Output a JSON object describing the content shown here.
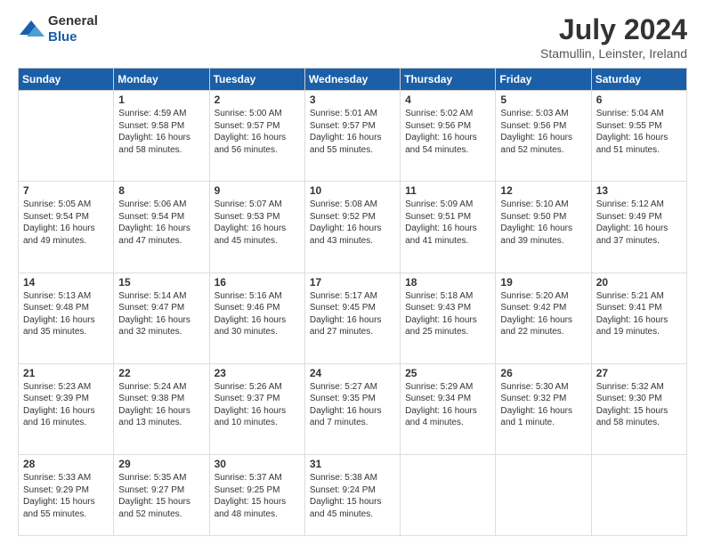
{
  "header": {
    "logo_general": "General",
    "logo_blue": "Blue",
    "title": "July 2024",
    "subtitle": "Stamullin, Leinster, Ireland"
  },
  "columns": [
    "Sunday",
    "Monday",
    "Tuesday",
    "Wednesday",
    "Thursday",
    "Friday",
    "Saturday"
  ],
  "weeks": [
    [
      {
        "day": "",
        "content": ""
      },
      {
        "day": "1",
        "content": "Sunrise: 4:59 AM\nSunset: 9:58 PM\nDaylight: 16 hours\nand 58 minutes."
      },
      {
        "day": "2",
        "content": "Sunrise: 5:00 AM\nSunset: 9:57 PM\nDaylight: 16 hours\nand 56 minutes."
      },
      {
        "day": "3",
        "content": "Sunrise: 5:01 AM\nSunset: 9:57 PM\nDaylight: 16 hours\nand 55 minutes."
      },
      {
        "day": "4",
        "content": "Sunrise: 5:02 AM\nSunset: 9:56 PM\nDaylight: 16 hours\nand 54 minutes."
      },
      {
        "day": "5",
        "content": "Sunrise: 5:03 AM\nSunset: 9:56 PM\nDaylight: 16 hours\nand 52 minutes."
      },
      {
        "day": "6",
        "content": "Sunrise: 5:04 AM\nSunset: 9:55 PM\nDaylight: 16 hours\nand 51 minutes."
      }
    ],
    [
      {
        "day": "7",
        "content": "Sunrise: 5:05 AM\nSunset: 9:54 PM\nDaylight: 16 hours\nand 49 minutes."
      },
      {
        "day": "8",
        "content": "Sunrise: 5:06 AM\nSunset: 9:54 PM\nDaylight: 16 hours\nand 47 minutes."
      },
      {
        "day": "9",
        "content": "Sunrise: 5:07 AM\nSunset: 9:53 PM\nDaylight: 16 hours\nand 45 minutes."
      },
      {
        "day": "10",
        "content": "Sunrise: 5:08 AM\nSunset: 9:52 PM\nDaylight: 16 hours\nand 43 minutes."
      },
      {
        "day": "11",
        "content": "Sunrise: 5:09 AM\nSunset: 9:51 PM\nDaylight: 16 hours\nand 41 minutes."
      },
      {
        "day": "12",
        "content": "Sunrise: 5:10 AM\nSunset: 9:50 PM\nDaylight: 16 hours\nand 39 minutes."
      },
      {
        "day": "13",
        "content": "Sunrise: 5:12 AM\nSunset: 9:49 PM\nDaylight: 16 hours\nand 37 minutes."
      }
    ],
    [
      {
        "day": "14",
        "content": "Sunrise: 5:13 AM\nSunset: 9:48 PM\nDaylight: 16 hours\nand 35 minutes."
      },
      {
        "day": "15",
        "content": "Sunrise: 5:14 AM\nSunset: 9:47 PM\nDaylight: 16 hours\nand 32 minutes."
      },
      {
        "day": "16",
        "content": "Sunrise: 5:16 AM\nSunset: 9:46 PM\nDaylight: 16 hours\nand 30 minutes."
      },
      {
        "day": "17",
        "content": "Sunrise: 5:17 AM\nSunset: 9:45 PM\nDaylight: 16 hours\nand 27 minutes."
      },
      {
        "day": "18",
        "content": "Sunrise: 5:18 AM\nSunset: 9:43 PM\nDaylight: 16 hours\nand 25 minutes."
      },
      {
        "day": "19",
        "content": "Sunrise: 5:20 AM\nSunset: 9:42 PM\nDaylight: 16 hours\nand 22 minutes."
      },
      {
        "day": "20",
        "content": "Sunrise: 5:21 AM\nSunset: 9:41 PM\nDaylight: 16 hours\nand 19 minutes."
      }
    ],
    [
      {
        "day": "21",
        "content": "Sunrise: 5:23 AM\nSunset: 9:39 PM\nDaylight: 16 hours\nand 16 minutes."
      },
      {
        "day": "22",
        "content": "Sunrise: 5:24 AM\nSunset: 9:38 PM\nDaylight: 16 hours\nand 13 minutes."
      },
      {
        "day": "23",
        "content": "Sunrise: 5:26 AM\nSunset: 9:37 PM\nDaylight: 16 hours\nand 10 minutes."
      },
      {
        "day": "24",
        "content": "Sunrise: 5:27 AM\nSunset: 9:35 PM\nDaylight: 16 hours\nand 7 minutes."
      },
      {
        "day": "25",
        "content": "Sunrise: 5:29 AM\nSunset: 9:34 PM\nDaylight: 16 hours\nand 4 minutes."
      },
      {
        "day": "26",
        "content": "Sunrise: 5:30 AM\nSunset: 9:32 PM\nDaylight: 16 hours\nand 1 minute."
      },
      {
        "day": "27",
        "content": "Sunrise: 5:32 AM\nSunset: 9:30 PM\nDaylight: 15 hours\nand 58 minutes."
      }
    ],
    [
      {
        "day": "28",
        "content": "Sunrise: 5:33 AM\nSunset: 9:29 PM\nDaylight: 15 hours\nand 55 minutes."
      },
      {
        "day": "29",
        "content": "Sunrise: 5:35 AM\nSunset: 9:27 PM\nDaylight: 15 hours\nand 52 minutes."
      },
      {
        "day": "30",
        "content": "Sunrise: 5:37 AM\nSunset: 9:25 PM\nDaylight: 15 hours\nand 48 minutes."
      },
      {
        "day": "31",
        "content": "Sunrise: 5:38 AM\nSunset: 9:24 PM\nDaylight: 15 hours\nand 45 minutes."
      },
      {
        "day": "",
        "content": ""
      },
      {
        "day": "",
        "content": ""
      },
      {
        "day": "",
        "content": ""
      }
    ]
  ]
}
